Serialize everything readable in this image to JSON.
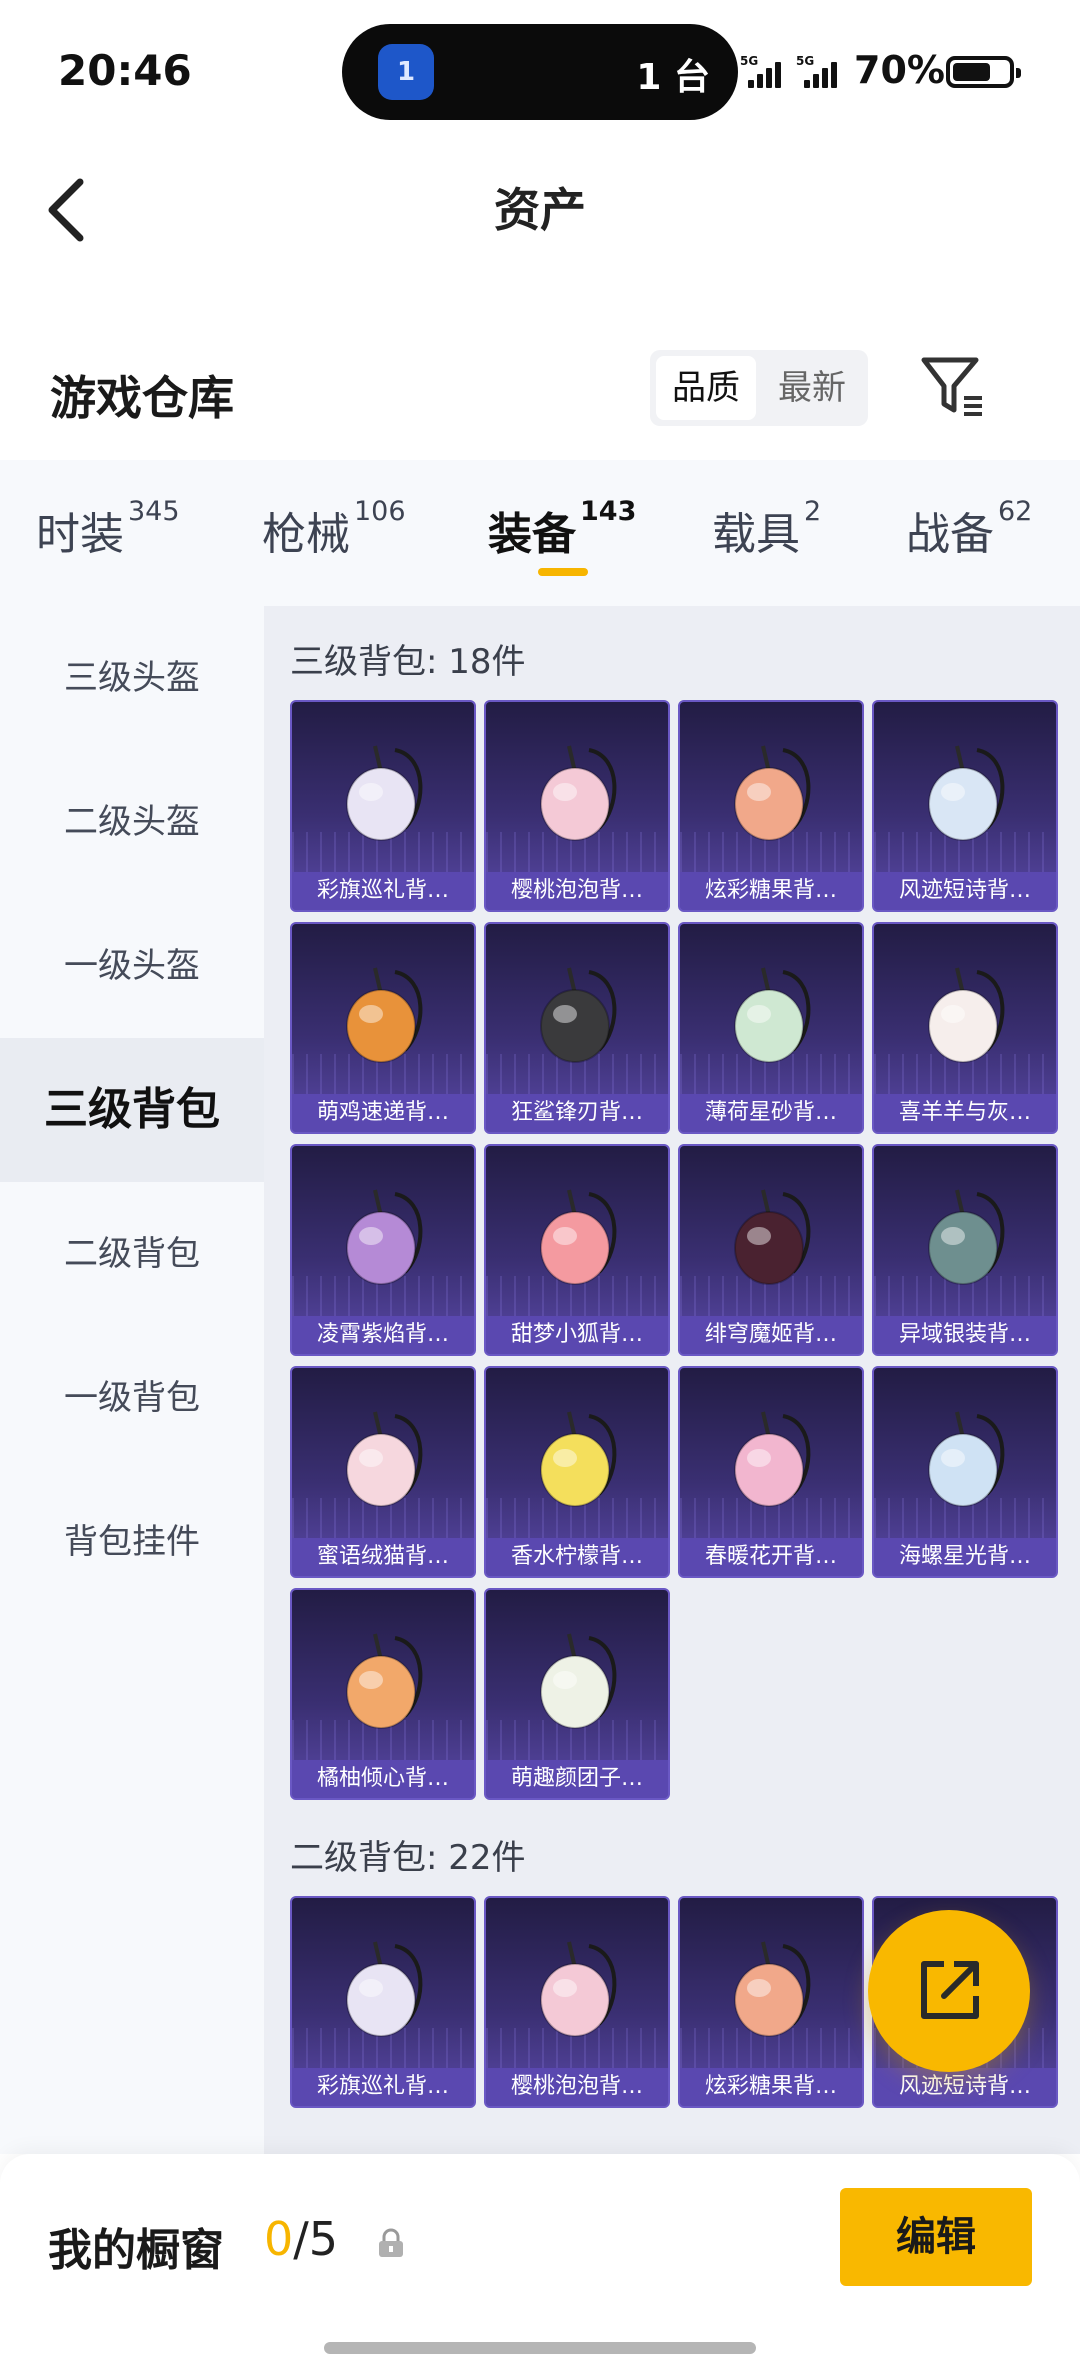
{
  "status_bar": {
    "time": "20:46",
    "island_badge": "1",
    "island_count": "1 台",
    "sim1": "5G",
    "sim2": "5G",
    "battery": "70%",
    "battery_level": 0.7
  },
  "header": {
    "title": "资产"
  },
  "warehouse": {
    "title": "游戏仓库",
    "sort_quality": "品质",
    "sort_latest": "最新"
  },
  "tabs": [
    {
      "label": "时装",
      "count": "345"
    },
    {
      "label": "枪械",
      "count": "106"
    },
    {
      "label": "装备",
      "count": "143"
    },
    {
      "label": "载具",
      "count": "2"
    },
    {
      "label": "战备",
      "count": "62"
    }
  ],
  "sidebar": [
    {
      "label": "三级头盔"
    },
    {
      "label": "二级头盔"
    },
    {
      "label": "一级头盔"
    },
    {
      "label": "三级背包"
    },
    {
      "label": "二级背包"
    },
    {
      "label": "一级背包"
    },
    {
      "label": "背包挂件"
    }
  ],
  "sections": [
    {
      "title": "三级背包: 18件",
      "items": [
        {
          "name": "彩旗巡礼背…",
          "color": "#e8e4f4"
        },
        {
          "name": "樱桃泡泡背…",
          "color": "#f4c9d6"
        },
        {
          "name": "炫彩糖果背…",
          "color": "#f1a88a"
        },
        {
          "name": "风迹短诗背…",
          "color": "#d9e6f5"
        },
        {
          "name": "萌鸡速递背…",
          "color": "#e8923a"
        },
        {
          "name": "狂鲨锋刃背…",
          "color": "#3a3a3c"
        },
        {
          "name": "薄荷星砂背…",
          "color": "#cfe8d2"
        },
        {
          "name": "喜羊羊与灰…",
          "color": "#f6eeec"
        },
        {
          "name": "凌霄紫焰背…",
          "color": "#b58ad6"
        },
        {
          "name": "甜梦小狐背…",
          "color": "#f49aa0"
        },
        {
          "name": "绯穹魔姬背…",
          "color": "#4a2230"
        },
        {
          "name": "异域银装背…",
          "color": "#6e8f8f"
        },
        {
          "name": "蜜语绒猫背…",
          "color": "#f6d7de"
        },
        {
          "name": "香水柠檬背…",
          "color": "#f4df5c"
        },
        {
          "name": "春暖花开背…",
          "color": "#f2b6cf"
        },
        {
          "name": "海螺星光背…",
          "color": "#cfe2f4"
        },
        {
          "name": "橘柚倾心背…",
          "color": "#f2a86a"
        },
        {
          "name": "萌趣颜团子…",
          "color": "#eef2e6"
        }
      ]
    },
    {
      "title": "二级背包: 22件",
      "items": [
        {
          "name": "彩旗巡礼背…",
          "color": "#e8e4f4"
        },
        {
          "name": "樱桃泡泡背…",
          "color": "#f4c9d6"
        },
        {
          "name": "炫彩糖果背…",
          "color": "#f1a88a"
        },
        {
          "name": "风迹短诗背…",
          "color": "#d9e6f5"
        }
      ]
    }
  ],
  "showcase": {
    "label": "我的橱窗",
    "used": "0",
    "total": "/5",
    "edit": "编辑"
  },
  "colors": {
    "accent": "#f9b800",
    "card_top": "#221c44",
    "card_bottom": "#5a49a8"
  }
}
